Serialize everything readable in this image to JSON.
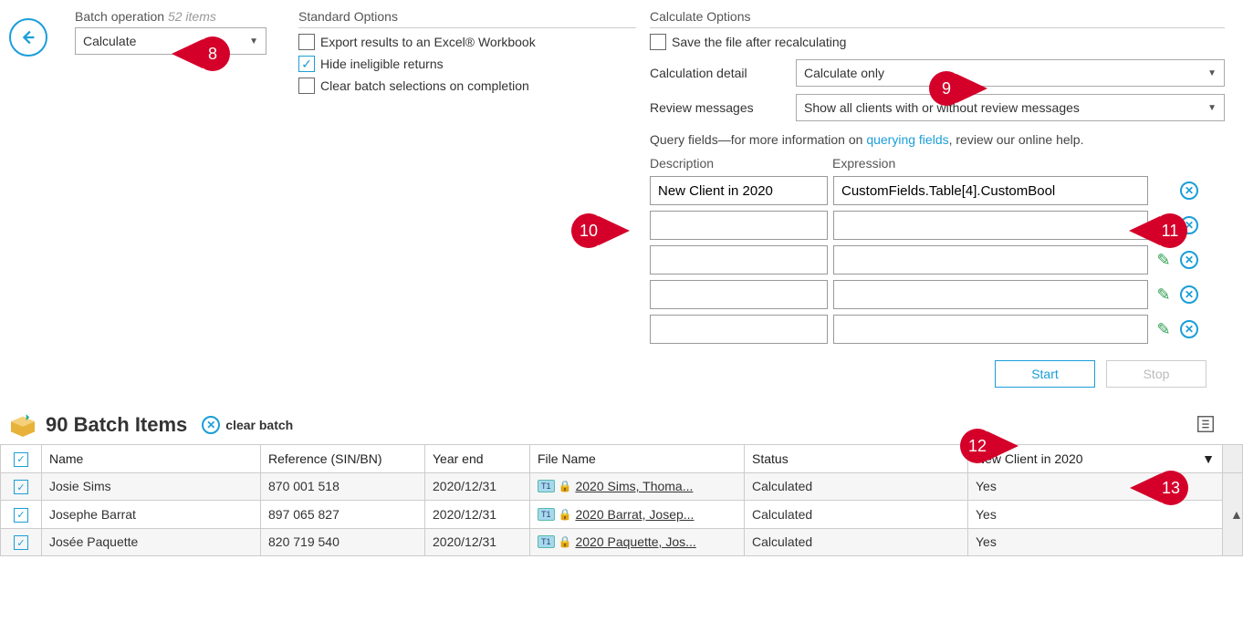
{
  "header": {
    "batch_operation_label": "Batch operation",
    "item_count": "52 items",
    "operation_value": "Calculate"
  },
  "standard_options": {
    "title": "Standard Options",
    "export_label": "Export results to an Excel® Workbook",
    "hide_label": "Hide ineligible returns",
    "clear_label": "Clear batch selections on completion"
  },
  "calculate_options": {
    "title": "Calculate Options",
    "save_label": "Save the file after recalculating",
    "calc_detail_label": "Calculation detail",
    "calc_detail_value": "Calculate only",
    "review_msg_label": "Review messages",
    "review_msg_value": "Show all clients with or without review messages",
    "query_help_pre": "Query fields—for more information on ",
    "query_help_link": "querying fields",
    "query_help_post": ", review our online help.",
    "desc_header": "Description",
    "expr_header": "Expression",
    "rows": [
      {
        "desc": "New Client in 2020",
        "expr": "CustomFields.Table[4].CustomBool"
      },
      {
        "desc": "",
        "expr": ""
      },
      {
        "desc": "",
        "expr": ""
      },
      {
        "desc": "",
        "expr": ""
      },
      {
        "desc": "",
        "expr": ""
      }
    ]
  },
  "buttons": {
    "start": "Start",
    "stop": "Stop"
  },
  "batch_items": {
    "title": "90 Batch Items",
    "clear_label": "clear batch",
    "columns": {
      "name": "Name",
      "reference": "Reference (SIN/BN)",
      "yearend": "Year end",
      "filename": "File Name",
      "status": "Status",
      "newclient": "New Client in 2020"
    },
    "rows": [
      {
        "name": "Josie Sims",
        "ref": "870 001 518",
        "ye": "2020/12/31",
        "file": "2020 Sims, Thoma...",
        "status": "Calculated",
        "new": "Yes"
      },
      {
        "name": "Josephe Barrat",
        "ref": "897 065 827",
        "ye": "2020/12/31",
        "file": "2020 Barrat, Josep...",
        "status": "Calculated",
        "new": "Yes"
      },
      {
        "name": "Josée Paquette",
        "ref": "820 719 540",
        "ye": "2020/12/31",
        "file": "2020 Paquette, Jos...",
        "status": "Calculated",
        "new": "Yes"
      }
    ]
  },
  "callouts": {
    "8": "8",
    "9": "9",
    "10": "10",
    "11": "11",
    "12": "12",
    "13": "13"
  }
}
